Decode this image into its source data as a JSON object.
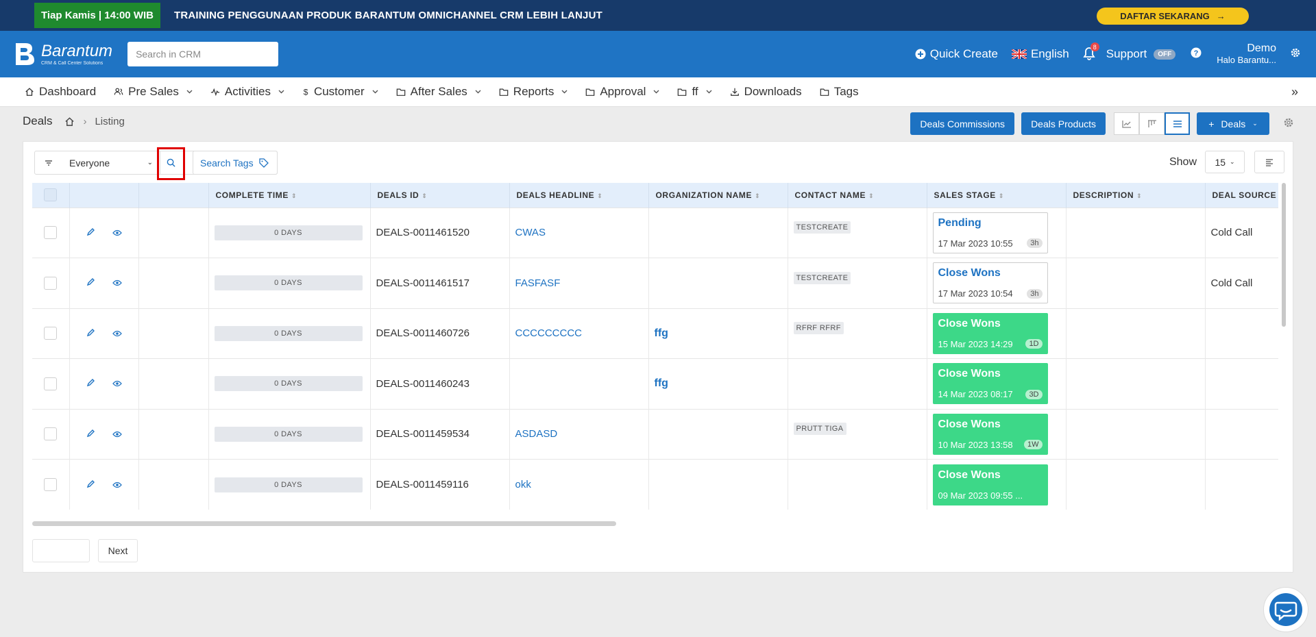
{
  "promo": {
    "badge": "Tiap Kamis | 14:00 WIB",
    "title": "TRAINING PENGGUNAAN PRODUK BARANTUM OMNICHANNEL CRM LEBIH LANJUT",
    "cta": "DAFTAR SEKARANG"
  },
  "header": {
    "brand": "Barantum",
    "tagline": "CRM & Call Center Solutions",
    "search_placeholder": "Search in CRM",
    "quick_create": "Quick Create",
    "language": "English",
    "notification_count": "8",
    "support": "Support",
    "support_state": "OFF",
    "user_name": "Demo",
    "user_greeting": "Halo Barantu..."
  },
  "nav": {
    "items": [
      {
        "label": "Dashboard",
        "icon": "home-icon",
        "dropdown": false
      },
      {
        "label": "Pre Sales",
        "icon": "users-icon",
        "dropdown": true
      },
      {
        "label": "Activities",
        "icon": "activity-icon",
        "dropdown": true
      },
      {
        "label": "Customer",
        "icon": "dollar-icon",
        "dropdown": true
      },
      {
        "label": "After Sales",
        "icon": "folder-icon",
        "dropdown": true
      },
      {
        "label": "Reports",
        "icon": "folder-icon",
        "dropdown": true
      },
      {
        "label": "Approval",
        "icon": "folder-icon",
        "dropdown": true
      },
      {
        "label": "ff",
        "icon": "folder-icon",
        "dropdown": true
      },
      {
        "label": "Downloads",
        "icon": "download-icon",
        "dropdown": false
      },
      {
        "label": "Tags",
        "icon": "folder-icon",
        "dropdown": false
      }
    ]
  },
  "page": {
    "title": "Deals",
    "breadcrumb_current": "Listing",
    "btn_commissions": "Deals Commissions",
    "btn_products": "Deals Products",
    "btn_add": "Deals"
  },
  "filters": {
    "owner": "Everyone",
    "search_tags": "Search Tags",
    "show_label": "Show",
    "show_value": "15"
  },
  "table": {
    "columns": [
      "",
      "",
      "",
      "COMPLETE TIME",
      "DEALS ID",
      "DEALS HEADLINE",
      "ORGANIZATION NAME",
      "CONTACT NAME",
      "SALES STAGE",
      "DESCRIPTION",
      "DEAL SOURCE"
    ],
    "rows": [
      {
        "complete": "0 DAYS",
        "id": "DEALS-0011461520",
        "headline": "CWAS",
        "org": "",
        "contact": "TESTCREATE",
        "stage": "Pending",
        "stage_date": "17 Mar 2023 10:55",
        "stage_ago": "3h",
        "won": false,
        "description": "",
        "source": "Cold Call"
      },
      {
        "complete": "0 DAYS",
        "id": "DEALS-0011461517",
        "headline": "FASFASF",
        "org": "",
        "contact": "TESTCREATE",
        "stage": "Close Wons",
        "stage_date": "17 Mar 2023 10:54",
        "stage_ago": "3h",
        "won": false,
        "description": "",
        "source": "Cold Call"
      },
      {
        "complete": "0 DAYS",
        "id": "DEALS-0011460726",
        "headline": "CCCCCCCCC",
        "org": "ffg",
        "contact": "RFRF RFRF",
        "stage": "Close Wons",
        "stage_date": "15 Mar 2023 14:29",
        "stage_ago": "1D",
        "won": true,
        "description": "",
        "source": ""
      },
      {
        "complete": "0 DAYS",
        "id": "DEALS-0011460243",
        "headline": "",
        "org": "ffg",
        "contact": "",
        "stage": "Close Wons",
        "stage_date": "14 Mar 2023 08:17",
        "stage_ago": "3D",
        "won": true,
        "description": "",
        "source": ""
      },
      {
        "complete": "0 DAYS",
        "id": "DEALS-0011459534",
        "headline": "ASDASD",
        "org": "",
        "contact": "PRUTT TIGA",
        "stage": "Close Wons",
        "stage_date": "10 Mar 2023 13:58",
        "stage_ago": "1W",
        "won": true,
        "description": "",
        "source": ""
      },
      {
        "complete": "0 DAYS",
        "id": "DEALS-0011459116",
        "headline": "okk",
        "org": "",
        "contact": "",
        "stage": "Close Wons",
        "stage_date": "09 Mar 2023 09:55 ...",
        "stage_ago": "",
        "won": true,
        "description": "",
        "source": ""
      }
    ]
  },
  "pager": {
    "next": "Next"
  },
  "colors": {
    "brand_blue": "#1f74c4",
    "promo_bg": "#173a6a",
    "won_green": "#3dd888",
    "cta_yellow": "#f4c51c"
  }
}
